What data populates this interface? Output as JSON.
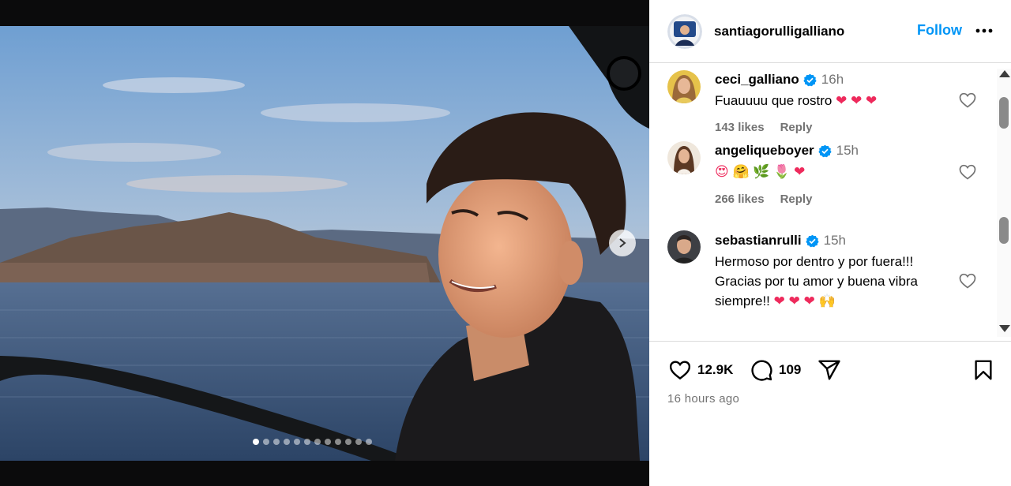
{
  "post": {
    "image_alt": "Young man on a boat at sunset with lake and mountains behind",
    "carousel_total": 12,
    "carousel_active_index": 0
  },
  "header": {
    "username": "santiagorulligalliano",
    "follow_label": "Follow"
  },
  "comments": [
    {
      "username": "ceci_galliano",
      "verified": true,
      "time": "16h",
      "text": "Fuauuuu que rostro",
      "hearts": "❤ ❤ ❤",
      "likes": "143 likes",
      "reply": "Reply"
    },
    {
      "username": "angeliqueboyer",
      "verified": true,
      "time": "15h",
      "text": "😍 🤗 🌿 🌷 ❤",
      "likes": "266 likes",
      "reply": "Reply"
    },
    {
      "username": "sebastianrulli",
      "verified": true,
      "time": "15h",
      "text": "Hermoso por dentro y por fuera!!! Gracias por tu amor y buena vibra siempre!!",
      "hearts": "❤ ❤ ❤ 🙌"
    }
  ],
  "actions": {
    "like_count": "12.9K",
    "comment_count": "109",
    "posted_ago": "16 hours ago"
  },
  "colors": {
    "accent": "#0095f6",
    "verified": "#0095f6",
    "heart_emoji": "#ee2a5c",
    "muted_text": "#737373"
  },
  "icons": {
    "next": "chevron-right-icon",
    "more": "more-horizontal-icon",
    "like": "heart-outline-icon",
    "comment": "comment-bubble-icon",
    "share": "send-icon",
    "save": "bookmark-icon",
    "verified": "verified-badge-icon"
  }
}
